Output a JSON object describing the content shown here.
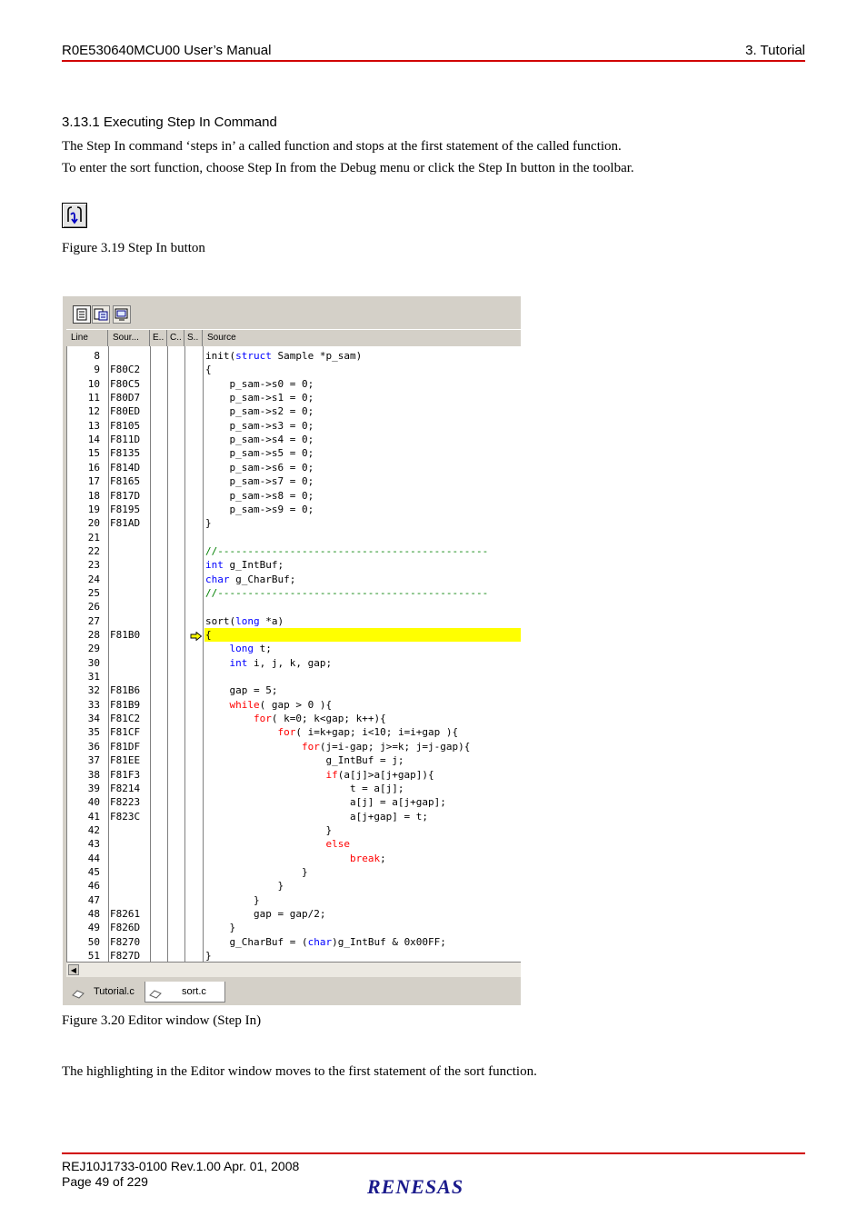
{
  "header": {
    "left": "R0E530640MCU00 User’s Manual",
    "right": "3. Tutorial"
  },
  "section": {
    "title": "3.13.1 Executing Step In Command",
    "para1": "The Step In command ‘steps in’ a called function and stops at the first statement of the called function.",
    "para2": "To enter the sort function, choose Step In from the Debug menu or click the Step In button in the toolbar."
  },
  "figures": {
    "fig19": "Figure 3.19 Step In button",
    "fig20": "Figure 3.20 Editor window (Step In)"
  },
  "editor": {
    "columns": [
      "Line",
      "Sour...",
      "E..",
      "C..",
      "S..",
      "Source"
    ],
    "tabs": [
      "Tutorial.c",
      "sort.c"
    ],
    "highlight_line": "28",
    "lines": [
      {
        "n": "8",
        "a": "",
        "s": [
          [
            "",
            "init("
          ],
          [
            "kw",
            "struct"
          ],
          [
            "",
            " Sample *p_sam)"
          ]
        ]
      },
      {
        "n": "9",
        "a": "F80C2",
        "s": [
          [
            "",
            "{"
          ]
        ]
      },
      {
        "n": "10",
        "a": "F80C5",
        "s": [
          [
            "",
            "    p_sam->s0 = 0;"
          ]
        ]
      },
      {
        "n": "11",
        "a": "F80D7",
        "s": [
          [
            "",
            "    p_sam->s1 = 0;"
          ]
        ]
      },
      {
        "n": "12",
        "a": "F80ED",
        "s": [
          [
            "",
            "    p_sam->s2 = 0;"
          ]
        ]
      },
      {
        "n": "13",
        "a": "F8105",
        "s": [
          [
            "",
            "    p_sam->s3 = 0;"
          ]
        ]
      },
      {
        "n": "14",
        "a": "F811D",
        "s": [
          [
            "",
            "    p_sam->s4 = 0;"
          ]
        ]
      },
      {
        "n": "15",
        "a": "F8135",
        "s": [
          [
            "",
            "    p_sam->s5 = 0;"
          ]
        ]
      },
      {
        "n": "16",
        "a": "F814D",
        "s": [
          [
            "",
            "    p_sam->s6 = 0;"
          ]
        ]
      },
      {
        "n": "17",
        "a": "F8165",
        "s": [
          [
            "",
            "    p_sam->s7 = 0;"
          ]
        ]
      },
      {
        "n": "18",
        "a": "F817D",
        "s": [
          [
            "",
            "    p_sam->s8 = 0;"
          ]
        ]
      },
      {
        "n": "19",
        "a": "F8195",
        "s": [
          [
            "",
            "    p_sam->s9 = 0;"
          ]
        ]
      },
      {
        "n": "20",
        "a": "F81AD",
        "s": [
          [
            "",
            "}"
          ]
        ]
      },
      {
        "n": "21",
        "a": "",
        "s": []
      },
      {
        "n": "22",
        "a": "",
        "s": [
          [
            "cm",
            "//---------------------------------------------"
          ]
        ]
      },
      {
        "n": "23",
        "a": "",
        "s": [
          [
            "kw",
            "int"
          ],
          [
            "",
            " g_IntBuf;"
          ]
        ]
      },
      {
        "n": "24",
        "a": "",
        "s": [
          [
            "kw",
            "char"
          ],
          [
            "",
            " g_CharBuf;"
          ]
        ]
      },
      {
        "n": "25",
        "a": "",
        "s": [
          [
            "cm",
            "//---------------------------------------------"
          ]
        ]
      },
      {
        "n": "26",
        "a": "",
        "s": []
      },
      {
        "n": "27",
        "a": "",
        "s": [
          [
            "",
            "sort("
          ],
          [
            "kw",
            "long"
          ],
          [
            "",
            " *a)"
          ]
        ]
      },
      {
        "n": "28",
        "a": "F81B0",
        "s": [
          [
            "",
            "{"
          ]
        ]
      },
      {
        "n": "29",
        "a": "",
        "s": [
          [
            "",
            "    "
          ],
          [
            "kw",
            "long"
          ],
          [
            "",
            " t;"
          ]
        ]
      },
      {
        "n": "30",
        "a": "",
        "s": [
          [
            "",
            "    "
          ],
          [
            "kw",
            "int"
          ],
          [
            "",
            " i, j, k, gap;"
          ]
        ]
      },
      {
        "n": "31",
        "a": "",
        "s": []
      },
      {
        "n": "32",
        "a": "F81B6",
        "s": [
          [
            "",
            "    gap = 5;"
          ]
        ]
      },
      {
        "n": "33",
        "a": "F81B9",
        "s": [
          [
            "",
            "    "
          ],
          [
            "rd",
            "while"
          ],
          [
            "",
            "( gap > 0 ){"
          ]
        ]
      },
      {
        "n": "34",
        "a": "F81C2",
        "s": [
          [
            "",
            "        "
          ],
          [
            "rd",
            "for"
          ],
          [
            "",
            "( k=0; k<gap; k++){"
          ]
        ]
      },
      {
        "n": "35",
        "a": "F81CF",
        "s": [
          [
            "",
            "            "
          ],
          [
            "rd",
            "for"
          ],
          [
            "",
            "( i=k+gap; i<10; i=i+gap ){"
          ]
        ]
      },
      {
        "n": "36",
        "a": "F81DF",
        "s": [
          [
            "",
            "                "
          ],
          [
            "rd",
            "for"
          ],
          [
            "",
            "(j=i-gap; j>=k; j=j-gap){"
          ]
        ]
      },
      {
        "n": "37",
        "a": "F81EE",
        "s": [
          [
            "",
            "                    g_IntBuf = j;"
          ]
        ]
      },
      {
        "n": "38",
        "a": "F81F3",
        "s": [
          [
            "",
            "                    "
          ],
          [
            "rd",
            "if"
          ],
          [
            "",
            "(a[j]>a[j+gap]){"
          ]
        ]
      },
      {
        "n": "39",
        "a": "F8214",
        "s": [
          [
            "",
            "                        t = a[j];"
          ]
        ]
      },
      {
        "n": "40",
        "a": "F8223",
        "s": [
          [
            "",
            "                        a[j] = a[j+gap];"
          ]
        ]
      },
      {
        "n": "41",
        "a": "F823C",
        "s": [
          [
            "",
            "                        a[j+gap] = t;"
          ]
        ]
      },
      {
        "n": "42",
        "a": "",
        "s": [
          [
            "",
            "                    }"
          ]
        ]
      },
      {
        "n": "43",
        "a": "",
        "s": [
          [
            "",
            "                    "
          ],
          [
            "rd",
            "else"
          ]
        ]
      },
      {
        "n": "44",
        "a": "",
        "s": [
          [
            "",
            "                        "
          ],
          [
            "rd",
            "break"
          ],
          [
            "",
            ";"
          ]
        ]
      },
      {
        "n": "45",
        "a": "",
        "s": [
          [
            "",
            "                }"
          ]
        ]
      },
      {
        "n": "46",
        "a": "",
        "s": [
          [
            "",
            "            }"
          ]
        ]
      },
      {
        "n": "47",
        "a": "",
        "s": [
          [
            "",
            "        }"
          ]
        ]
      },
      {
        "n": "48",
        "a": "F8261",
        "s": [
          [
            "",
            "        gap = gap/2;"
          ]
        ]
      },
      {
        "n": "49",
        "a": "F826D",
        "s": [
          [
            "",
            "    }"
          ]
        ]
      },
      {
        "n": "50",
        "a": "F8270",
        "s": [
          [
            "",
            "    g_CharBuf = ("
          ],
          [
            "kw",
            "char"
          ],
          [
            "",
            ")g_IntBuf & 0x00FF;"
          ]
        ]
      },
      {
        "n": "51",
        "a": "F827D",
        "s": [
          [
            "",
            "}"
          ]
        ]
      }
    ]
  },
  "body_text": "The highlighting in the Editor window moves to the first statement of the sort function.",
  "footer": {
    "doc": "REJ10J1733-0100   Rev.1.00   Apr. 01, 2008",
    "page": "Page 49 of 229",
    "logo": "RENESAS"
  },
  "colors": {
    "rule": "#d00000",
    "highlight": "#ffff00",
    "keyword_blue": "#0000ff",
    "keyword_red": "#ff0000",
    "comment": "#008000"
  }
}
